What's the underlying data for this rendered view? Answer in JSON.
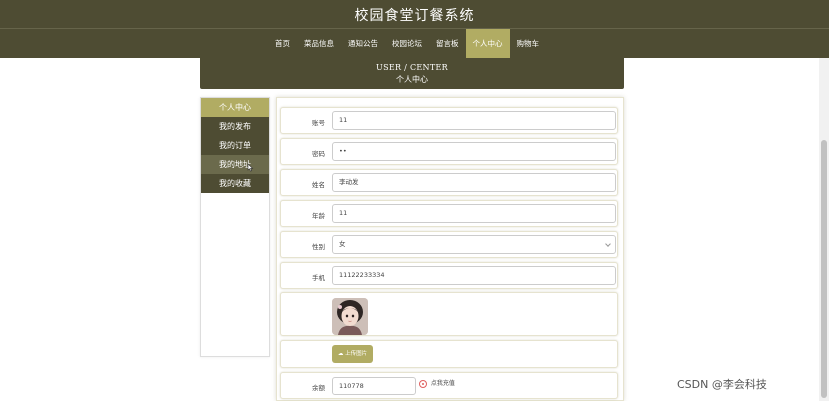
{
  "header": {
    "title": "校园食堂订餐系统"
  },
  "nav": {
    "items": [
      {
        "label": "首页"
      },
      {
        "label": "菜品信息"
      },
      {
        "label": "通知公告"
      },
      {
        "label": "校园论坛"
      },
      {
        "label": "留言板"
      },
      {
        "label": "个人中心"
      },
      {
        "label": "购物车"
      }
    ],
    "active_index": 5
  },
  "banner": {
    "en": "USER / CENTER",
    "cn": "个人中心"
  },
  "sidebar": {
    "items": [
      {
        "label": "个人中心"
      },
      {
        "label": "我的发布"
      },
      {
        "label": "我的订单"
      },
      {
        "label": "我的地址"
      },
      {
        "label": "我的收藏"
      }
    ]
  },
  "form": {
    "account_label": "账号",
    "account_value": "11",
    "password_label": "密码",
    "password_value": "••",
    "name_label": "姓名",
    "name_value": "李动发",
    "age_label": "年龄",
    "age_value": "11",
    "gender_label": "性别",
    "gender_value": "女",
    "phone_label": "手机",
    "phone_value": "11122233334",
    "upload_label": "上传图片",
    "balance_label": "余额",
    "balance_value": "110778",
    "recharge_label": "点我充值"
  },
  "colors": {
    "primary": "#4e4c33",
    "accent": "#b1ac63"
  },
  "watermark": "CSDN @李会科技"
}
